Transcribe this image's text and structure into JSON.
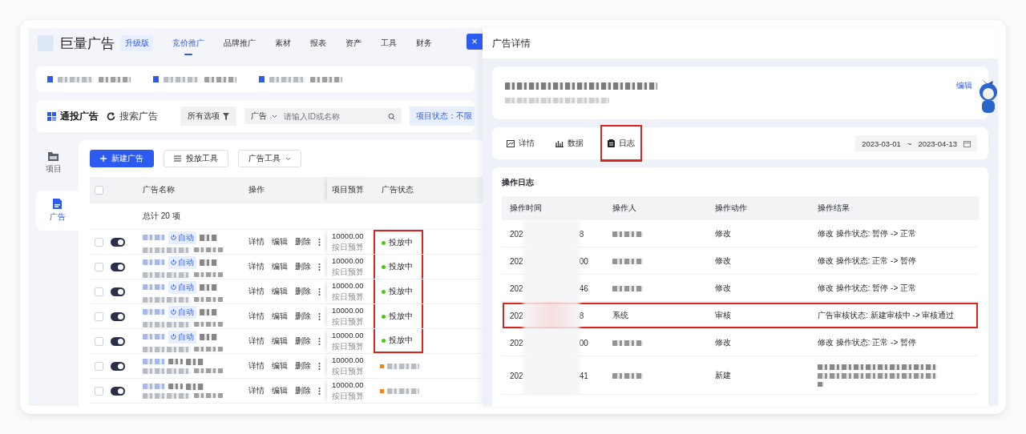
{
  "header": {
    "logo": "巨量广告",
    "badge": "升级版",
    "nav": [
      {
        "label": "竞价推广",
        "selected": true
      },
      {
        "label": "品牌推广",
        "selected": false
      },
      {
        "label": "素材",
        "selected": false
      },
      {
        "label": "报表",
        "selected": false
      },
      {
        "label": "资产",
        "selected": false
      },
      {
        "label": "工具",
        "selected": false
      },
      {
        "label": "财务",
        "selected": false
      }
    ]
  },
  "filter_bar": {
    "modes": [
      {
        "label": "通投广告",
        "selected": true
      },
      {
        "label": "搜索广告",
        "selected": false
      }
    ],
    "all_options": "所有选项",
    "search": {
      "scope": "广告",
      "placeholder": "请输入ID或名称"
    },
    "status_filter": "项目状态：不限"
  },
  "sidebar": [
    {
      "label": "项目",
      "selected": false
    },
    {
      "label": "广告",
      "selected": true
    }
  ],
  "toolbar": [
    {
      "label": "新建广告",
      "kind": "primary"
    },
    {
      "label": "投放工具",
      "kind": "list"
    },
    {
      "label": "广告工具",
      "kind": "dropdown"
    }
  ],
  "ads": {
    "columns": [
      "广告名称",
      "操作",
      "项目预算",
      "广告状态"
    ],
    "summary": "总计 20 项",
    "select_all_checked": false,
    "rows": [
      {
        "checked": false,
        "on": true,
        "tag": "自动",
        "actions": [
          "详情",
          "编辑",
          "删除"
        ],
        "budget": "10000.00",
        "budget_type": "按日预算",
        "status": {
          "kind": "dot",
          "text": "投放中"
        },
        "highlighted": true
      },
      {
        "checked": false,
        "on": true,
        "tag": "自动",
        "actions": [
          "详情",
          "编辑",
          "删除"
        ],
        "budget": "10000.00",
        "budget_type": "按日预算",
        "status": {
          "kind": "dot",
          "text": "投放中"
        },
        "highlighted": true
      },
      {
        "checked": false,
        "on": true,
        "tag": "自动",
        "actions": [
          "详情",
          "编辑",
          "删除"
        ],
        "budget": "10000.00",
        "budget_type": "按日预算",
        "status": {
          "kind": "dot",
          "text": "投放中"
        },
        "highlighted": true
      },
      {
        "checked": false,
        "on": true,
        "tag": "自动",
        "actions": [
          "详情",
          "编辑",
          "删除"
        ],
        "budget": "10000.00",
        "budget_type": "按日预算",
        "status": {
          "kind": "dot",
          "text": "投放中"
        },
        "highlighted": true
      },
      {
        "checked": false,
        "on": true,
        "tag": "自动",
        "actions": [
          "详情",
          "编辑",
          "删除"
        ],
        "budget": "10000.00",
        "budget_type": "按日预算",
        "status": {
          "kind": "dot",
          "text": "投放中"
        },
        "highlighted": true
      },
      {
        "checked": false,
        "on": true,
        "actions": [
          "详情",
          "编辑",
          "删除"
        ],
        "budget": "10000.00",
        "budget_type": "按日预算",
        "status": {
          "kind": "redacted"
        },
        "highlighted": false
      },
      {
        "checked": false,
        "on": true,
        "actions": [
          "详情",
          "编辑",
          "删除"
        ],
        "budget": "10000.00",
        "budget_type": "按日预算",
        "status": {
          "kind": "redacted"
        },
        "highlighted": false
      }
    ]
  },
  "drawer": {
    "close": "×",
    "title": "广告详情",
    "edit": "编辑",
    "tabs": [
      {
        "label": "详情",
        "selected": false,
        "annotated": false
      },
      {
        "label": "数据",
        "selected": false,
        "annotated": false
      },
      {
        "label": "日志",
        "selected": true,
        "annotated": true
      }
    ],
    "date_range": {
      "start": "2023-03-01",
      "separator": "~",
      "end": "2023-04-13"
    },
    "log": {
      "title": "操作日志",
      "columns": [
        "操作时间",
        "操作人",
        "操作动作",
        "操作结果"
      ],
      "rows": [
        {
          "time_start": "202",
          "time_end": "8",
          "action": "修改",
          "result": "修改 操作状态: 暂停 -> 正常",
          "highlighted": false
        },
        {
          "time_start": "202",
          "time_end": "00",
          "action": "修改",
          "result": "修改 操作状态: 正常 -> 暂停",
          "highlighted": false
        },
        {
          "time_start": "202",
          "time_end": "46",
          "action": "修改",
          "result": "修改 操作状态: 暂停 -> 正常",
          "highlighted": false
        },
        {
          "time_start": "202",
          "time_end": "8",
          "operator": "系统",
          "action": "审核",
          "result": "广告审核状态: 新建审核中 -> 审核通过",
          "highlighted": true
        },
        {
          "time_start": "202",
          "time_end": "00",
          "action": "修改",
          "result": "修改 操作状态: 正常 -> 暂停",
          "highlighted": false
        },
        {
          "time_start": "202",
          "time_end": "41",
          "action": "新建",
          "highlighted": false
        }
      ]
    }
  }
}
